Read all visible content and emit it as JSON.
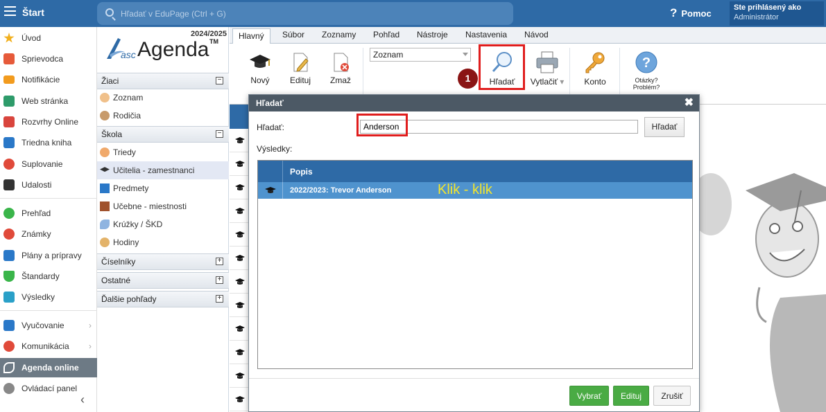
{
  "topbar": {
    "start_label": "Štart",
    "search_placeholder": "Hľadať v EduPage (Ctrl + G)",
    "help_label": "Pomoc",
    "user_line1": "Ste prihlásený ako",
    "user_line2": "Administrátor"
  },
  "leftnav": {
    "items": [
      {
        "label": "Úvod",
        "color": "#f2b01e"
      },
      {
        "label": "Sprievodca",
        "color": "#e65a3a"
      },
      {
        "label": "Notifikácie",
        "color": "#f29b1e"
      },
      {
        "label": "Web stránka",
        "color": "#2e9b6a"
      },
      {
        "label": "Rozvrhy Online",
        "color": "#d9453d"
      },
      {
        "label": "Triedna kniha",
        "color": "#2a78c8"
      },
      {
        "label": "Suplovanie",
        "color": "#e04a3a"
      },
      {
        "label": "Udalosti",
        "color": "#333333"
      },
      {
        "label": "Prehľad",
        "color": "#3ab54a"
      },
      {
        "label": "Známky",
        "color": "#e04a3a"
      },
      {
        "label": "Plány a prípravy",
        "color": "#2a78c8"
      },
      {
        "label": "Štandardy",
        "color": "#3ab54a"
      },
      {
        "label": "Výsledky",
        "color": "#2aa0c8"
      },
      {
        "label": "Vyučovanie",
        "color": "#2a78c8"
      },
      {
        "label": "Komunikácia",
        "color": "#e04a3a"
      },
      {
        "label": "Agenda online",
        "color": "#ffffff"
      },
      {
        "label": "Ovládací panel",
        "color": "#888888"
      }
    ]
  },
  "agenda": {
    "year": "2024/2025",
    "logo_prefix": "asc",
    "logo_name": "Agenda",
    "logo_tm": "TM",
    "sections": {
      "ziaci": "Žiaci",
      "skola": "Škola",
      "ciselniky": "Číselníky",
      "ostatne": "Ostatné",
      "dalsie": "Ďalšie pohľady"
    },
    "ziaci_items": [
      "Zoznam",
      "Rodičia"
    ],
    "skola_items": [
      "Triedy",
      "Učitelia - zamestnanci",
      "Predmety",
      "Učebne - miestnosti",
      "Krúžky / ŠKD",
      "Hodiny"
    ]
  },
  "ribbon": {
    "tabs": [
      "Hlavný",
      "Súbor",
      "Zoznamy",
      "Pohľad",
      "Nástroje",
      "Nastavenia",
      "Návod"
    ],
    "novy": "Nový",
    "edituj": "Edituj",
    "zmaz": "Zmaž",
    "combo_value": "Zoznam",
    "hladat": "Hľadať",
    "vytlacit": "Vytlačiť",
    "konto": "Konto",
    "otazky": "Otázky?",
    "problem": "Problém?"
  },
  "callout": {
    "badge": "1"
  },
  "dialog": {
    "title": "Hľadať",
    "close": "✖",
    "search_label": "Hľadať:",
    "search_value": "Anderson",
    "search_button": "Hľadať",
    "results_label": "Výsledky:",
    "column_header": "Popis",
    "rows": [
      {
        "text": "2022/2023: Trevor Anderson"
      }
    ],
    "annotation": "Klik - klik",
    "buttons": {
      "select": "Vybrať",
      "edit": "Edituj",
      "cancel": "Zrušiť"
    }
  }
}
